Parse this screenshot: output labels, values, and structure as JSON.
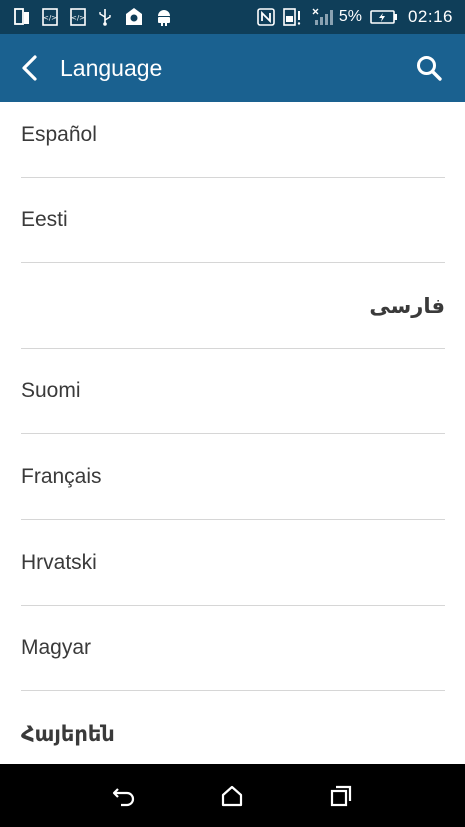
{
  "status_bar": {
    "left_icons": [
      "tablet-icon",
      "code-icon",
      "code-icon",
      "usb-icon",
      "location-icon",
      "android-icon"
    ],
    "right_icons": [
      "nfc-icon",
      "sim-alert-icon",
      "signal-icon",
      "battery-icon"
    ],
    "battery_percent": "5%",
    "time": "02:16"
  },
  "app_bar": {
    "title": "Language",
    "back_icon": "back-arrow-icon",
    "search_icon": "search-icon",
    "color": "#1a6190"
  },
  "languages": [
    {
      "label": "Español"
    },
    {
      "label": "Eesti"
    },
    {
      "label": "فارسی"
    },
    {
      "label": "Suomi"
    },
    {
      "label": "Français"
    },
    {
      "label": "Hrvatski"
    },
    {
      "label": "Magyar"
    },
    {
      "label": "Հայերեն"
    }
  ],
  "nav_bar": {
    "buttons": [
      "back-icon",
      "home-icon",
      "recents-icon"
    ]
  },
  "colors": {
    "status_bar": "#0f3e59",
    "app_bar": "#1a6190",
    "divider": "#d6d6d6",
    "text": "#3a3a3a"
  }
}
